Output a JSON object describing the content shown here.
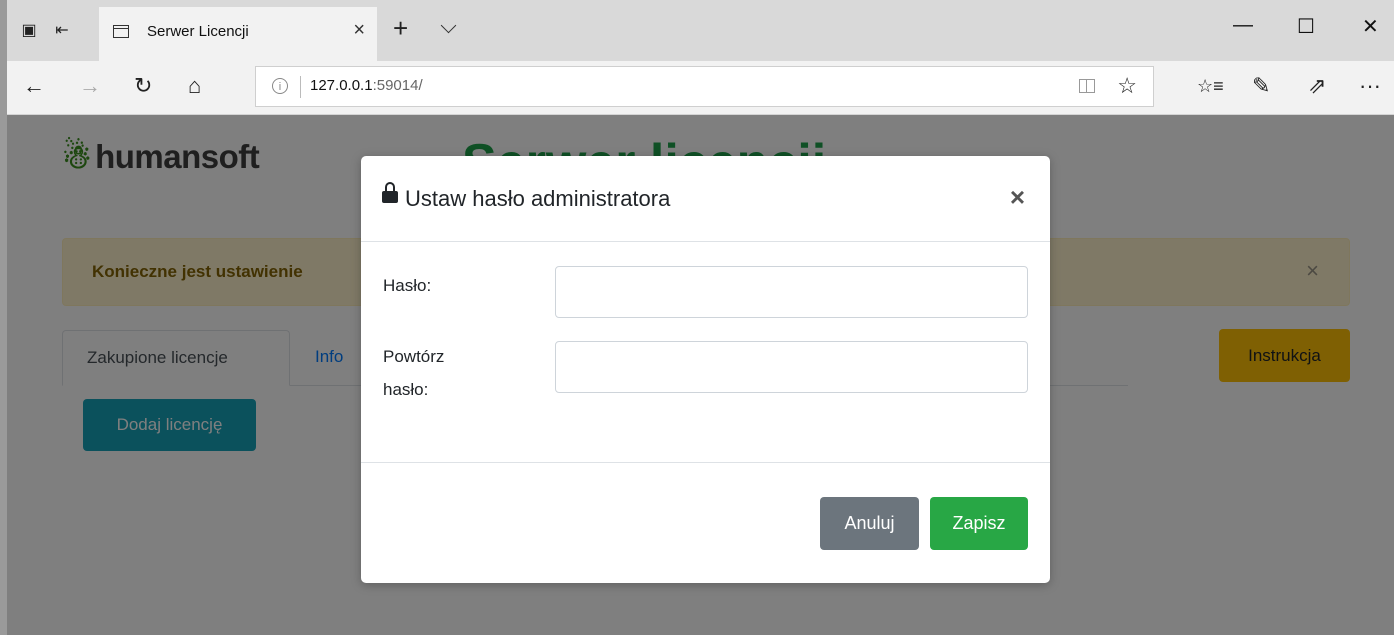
{
  "browser": {
    "tab_title": "Serwer Licencji",
    "tab_close": "×",
    "new_tab": "+",
    "url_host": "127.0.0.1",
    "url_rest": ":59014/",
    "minimize": "—",
    "maximize": "☐",
    "close": "✕",
    "back": "←",
    "forward": "→",
    "refresh": "↻",
    "home": "⌂",
    "favorite": "☆",
    "favorites": "☆≡",
    "notes": "✎",
    "share": "⇗",
    "more": "···"
  },
  "page": {
    "logo_text": "humansoft",
    "logo_mark": "☃",
    "big_title": "Serwer licencji",
    "alert_text": "Konieczne jest ustawienie",
    "alert_close": "×",
    "tab_active": "Zakupione licencje",
    "tab_info": "Info",
    "instr_button": "Instrukcja",
    "add_button": "Dodaj licencję"
  },
  "modal": {
    "title": "Ustaw hasło administratora",
    "close": "×",
    "password_label": "Hasło:",
    "password_value": "",
    "repeat_label_1": "Powtórz",
    "repeat_label_2": "hasło:",
    "repeat_value": "",
    "cancel": "Anuluj",
    "save": "Zapisz"
  },
  "colors": {
    "save": "#28a745",
    "cancel": "#6c757d",
    "instr": "#ffc107",
    "add": "#17a2b8",
    "alert_bg": "#fff3cd"
  }
}
